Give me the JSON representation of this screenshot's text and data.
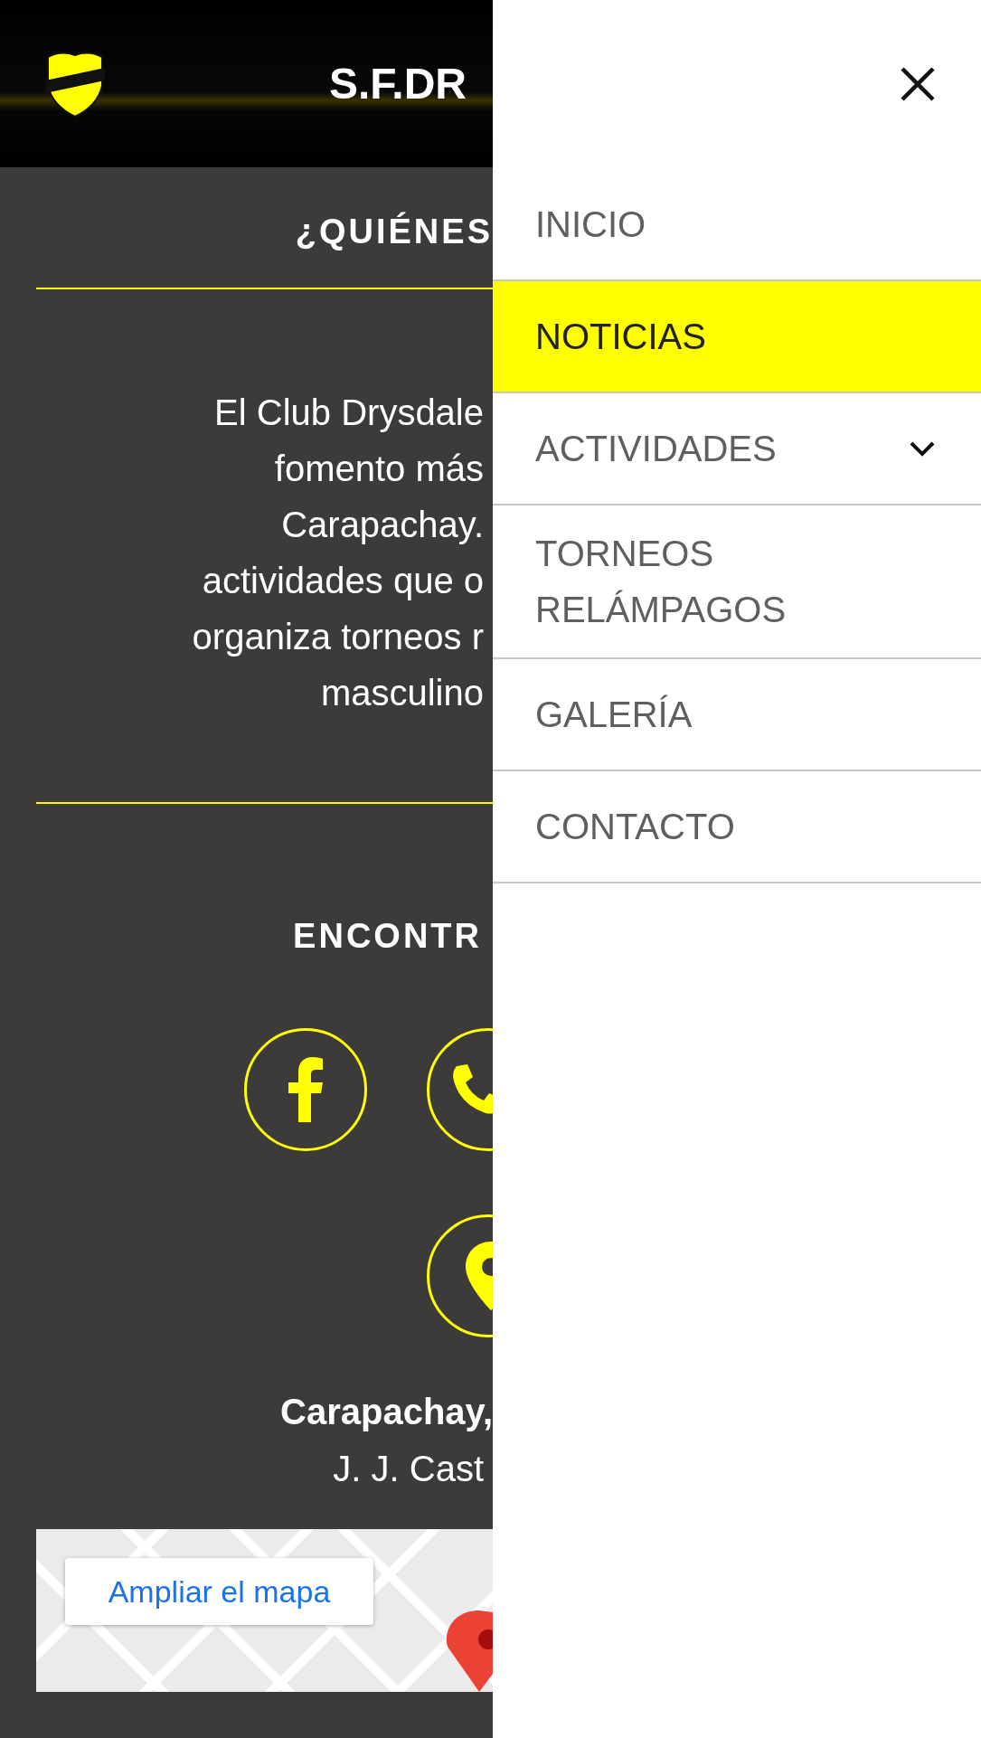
{
  "header": {
    "title": "S.F.DR"
  },
  "about": {
    "heading": "¿QUIÉNES",
    "lines": [
      "El Club Drysdale",
      "fomento más",
      "Carapachay.",
      "actividades que o",
      "organiza torneos r",
      "masculino"
    ]
  },
  "contact": {
    "heading": "ENCONTR",
    "address_bold": "Carapachay,",
    "address": "J. J. Cast",
    "map_button": "Ampliar el mapa"
  },
  "menu": {
    "items": [
      {
        "label": "INICIO",
        "selected": false,
        "kind": "link"
      },
      {
        "label": "NOTICIAS",
        "selected": true,
        "kind": "link"
      },
      {
        "label": "ACTIVIDADES",
        "selected": false,
        "kind": "submenu"
      },
      {
        "label": "TORNEOS RELÁMPAGOS",
        "selected": false,
        "kind": "link"
      },
      {
        "label": "GALERÍA",
        "selected": false,
        "kind": "link"
      },
      {
        "label": "CONTACTO",
        "selected": false,
        "kind": "link"
      }
    ]
  }
}
